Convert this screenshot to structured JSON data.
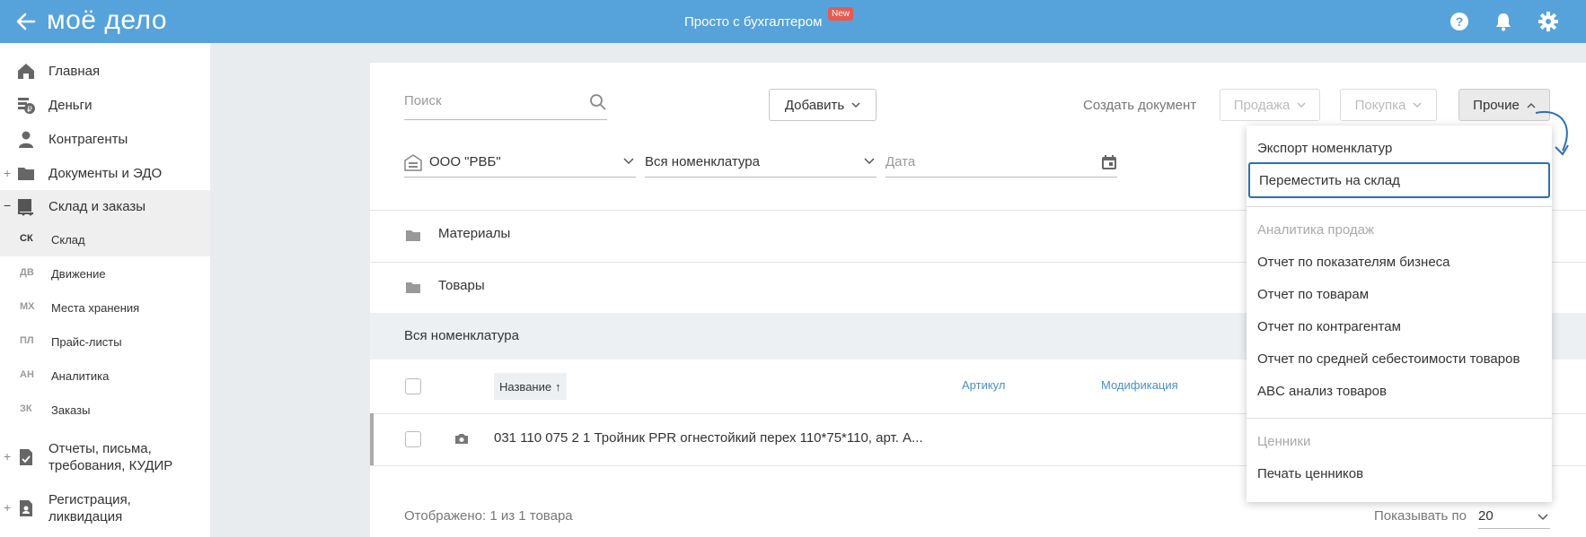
{
  "header": {
    "logo": "моё дело",
    "center_text": "Просто с бухгалтером",
    "badge": "New",
    "icons": [
      "back-arrow-icon",
      "help-icon",
      "bell-icon",
      "gear-icon"
    ],
    "bg_color": "#56a3dc"
  },
  "sidebar": {
    "items": [
      {
        "label": "Главная",
        "icon": "home-icon"
      },
      {
        "label": "Деньги",
        "icon": "money-icon"
      },
      {
        "label": "Контрагенты",
        "icon": "contractors-icon"
      },
      {
        "label": "Документы и ЭДО",
        "icon": "folder-icon",
        "expander": "+"
      },
      {
        "label": "Склад и заказы",
        "icon": "warehouse-icon",
        "expander": "−"
      }
    ],
    "subitems": [
      {
        "abbr": "СК",
        "label": "Склад"
      },
      {
        "abbr": "ДВ",
        "label": "Движение"
      },
      {
        "abbr": "МХ",
        "label": "Места хранения"
      },
      {
        "abbr": "ПЛ",
        "label": "Прайс-листы"
      },
      {
        "abbr": "АН",
        "label": "Аналитика"
      },
      {
        "abbr": "ЗК",
        "label": "Заказы"
      }
    ],
    "bottom_items": [
      {
        "label_line1": "Отчеты, письма,",
        "label_line2": "требования, КУДИР",
        "icon": "report-icon",
        "expander": "+"
      },
      {
        "label_line1": "Регистрация,",
        "label_line2": "ликвидация",
        "icon": "registration-icon",
        "expander": "+"
      }
    ]
  },
  "toolbar": {
    "search_placeholder": "Поиск",
    "add_button": "Добавить",
    "create_doc_label": "Создать документ",
    "sale_button": "Продажа",
    "purchase_button": "Покупка",
    "other_button": "Прочие"
  },
  "filters": {
    "organization": "ООО \"РВБ\"",
    "nomenclature": "Вся номенклатура",
    "date_placeholder": "Дата"
  },
  "folders": [
    "Материалы",
    "Товары"
  ],
  "table": {
    "section_title": "Вся номенклатура",
    "columns": {
      "name": "Название",
      "sort_indicator": "↑",
      "article": "Артикул",
      "modification": "Модификация"
    },
    "rows": [
      {
        "name": "031 110 075 2 1 Тройник PPR огнестойкий перех 110*75*110, арт. A..."
      }
    ]
  },
  "footer": {
    "shown": "Отображено: 1 из 1 товара",
    "per_page_label": "Показывать по",
    "per_page_value": "20"
  },
  "menu": {
    "items": [
      {
        "label": "Экспорт номенклатур",
        "type": "item"
      },
      {
        "label": "Переместить на склад",
        "type": "item",
        "focused": true
      },
      {
        "label": "Аналитика продаж",
        "type": "header"
      },
      {
        "label": "Отчет по показателям бизнеса",
        "type": "item"
      },
      {
        "label": "Отчет по товарам",
        "type": "item"
      },
      {
        "label": "Отчет по контрагентам",
        "type": "item"
      },
      {
        "label": "Отчет по средней себестоимости товаров",
        "type": "item"
      },
      {
        "label": "ABC анализ товаров",
        "type": "item"
      },
      {
        "label": "Ценники",
        "type": "header"
      },
      {
        "label": "Печать ценников",
        "type": "item"
      }
    ],
    "focus_color": "#2c6fb3"
  }
}
